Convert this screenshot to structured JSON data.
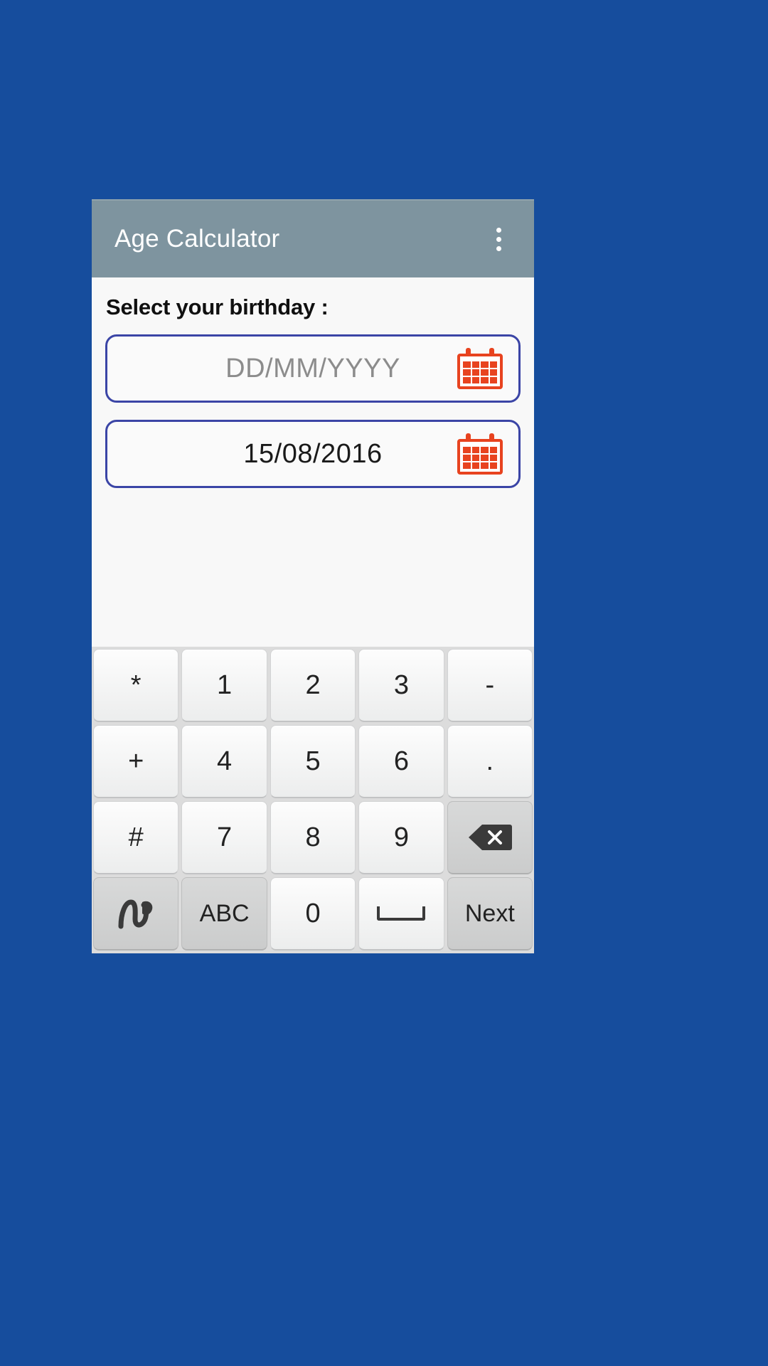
{
  "app": {
    "background_color": "#164d9d",
    "appbar_color": "#7e949f",
    "title": "Age Calculator",
    "overflow_icon": "more-vertical-icon"
  },
  "form": {
    "label": "Select your birthday :",
    "fields": [
      {
        "name": "birthday-input",
        "value": "",
        "placeholder": "DD/MM/YYYY",
        "icon": "calendar-icon",
        "border_color": "#3b45a6"
      },
      {
        "name": "date-input",
        "value": "15/08/2016",
        "placeholder": "DD/MM/YYYY",
        "icon": "calendar-icon",
        "border_color": "#3b45a6"
      }
    ]
  },
  "keyboard": {
    "rows": [
      [
        {
          "label": "*",
          "name": "key-asterisk",
          "type": "normal"
        },
        {
          "label": "1",
          "name": "key-1",
          "type": "normal"
        },
        {
          "label": "2",
          "name": "key-2",
          "type": "normal"
        },
        {
          "label": "3",
          "name": "key-3",
          "type": "normal"
        },
        {
          "label": "-",
          "name": "key-minus",
          "type": "normal"
        }
      ],
      [
        {
          "label": "+",
          "name": "key-plus",
          "type": "normal"
        },
        {
          "label": "4",
          "name": "key-4",
          "type": "normal"
        },
        {
          "label": "5",
          "name": "key-5",
          "type": "normal"
        },
        {
          "label": "6",
          "name": "key-6",
          "type": "normal"
        },
        {
          "label": ".",
          "name": "key-period",
          "type": "normal"
        }
      ],
      [
        {
          "label": "#",
          "name": "key-hash",
          "type": "normal"
        },
        {
          "label": "7",
          "name": "key-7",
          "type": "normal"
        },
        {
          "label": "8",
          "name": "key-8",
          "type": "normal"
        },
        {
          "label": "9",
          "name": "key-9",
          "type": "normal"
        },
        {
          "label": "",
          "name": "key-backspace",
          "type": "mod",
          "icon": "backspace-icon"
        }
      ],
      [
        {
          "label": "",
          "name": "key-handwriting",
          "type": "mod",
          "icon": "handwriting-icon"
        },
        {
          "label": "ABC",
          "name": "key-abc",
          "type": "mod"
        },
        {
          "label": "0",
          "name": "key-0",
          "type": "normal"
        },
        {
          "label": "",
          "name": "key-space",
          "type": "normal",
          "icon": "space-icon"
        },
        {
          "label": "Next",
          "name": "key-next",
          "type": "mod"
        }
      ]
    ]
  }
}
